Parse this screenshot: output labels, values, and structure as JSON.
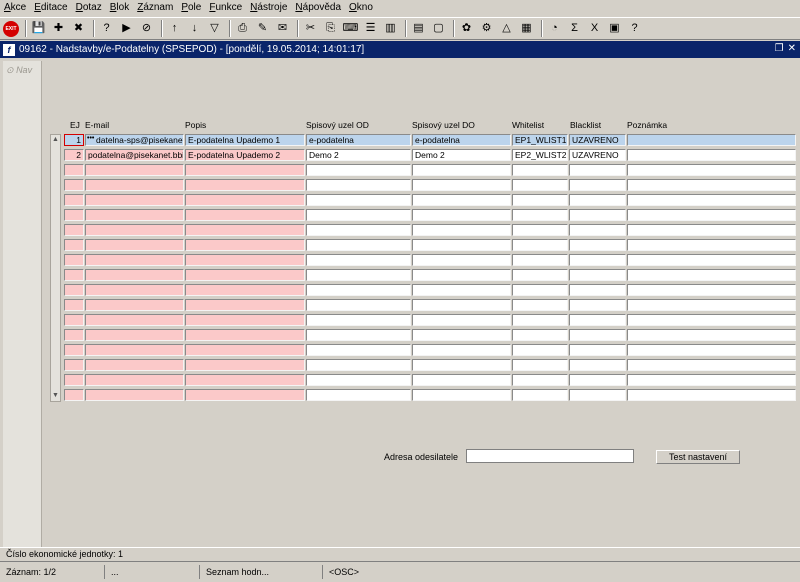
{
  "menu": [
    "Akce",
    "Editace",
    "Dotaz",
    "Blok",
    "Záznam",
    "Pole",
    "Funkce",
    "Nástroje",
    "Nápověda",
    "Okno"
  ],
  "toolbar_icons": [
    "exit-icon",
    "save-icon",
    "new-record-icon",
    "delete-record-icon",
    "enter-query-icon",
    "execute-query-icon",
    "cancel-query-icon",
    "sort-asc-icon",
    "sort-desc-icon",
    "filter-icon",
    "print-icon",
    "attachment-icon",
    "mail-icon",
    "cut-icon",
    "copy-icon",
    "paste-icon",
    "indent-icon",
    "columns-icon",
    "report-icon",
    "document-icon",
    "settings-icon",
    "gear-icon",
    "warning-icon",
    "chart-icon",
    "history-icon",
    "sum-icon",
    "excel-icon",
    "calculator-icon",
    "help-icon"
  ],
  "window": {
    "title": "09162 - Nadstavby/e-Podatelny (SPSEPOD) - [pondělí, 19.05.2014; 14:01:17]",
    "icon_letter": "f"
  },
  "nav_label": "Nav",
  "columns": [
    "EJ",
    "E-mail",
    "Popis",
    "Spisový uzel OD",
    "Spisový uzel DO",
    "Whitelist",
    "Blacklist",
    "Poznámka"
  ],
  "rows": [
    {
      "ej": "1",
      "email": "datelna-sps@pisekanet.bbi",
      "popis": "E-podatelna Upademo 1",
      "od": "e-podatelna",
      "do": "e-podatelna",
      "whitelist": "EP1_WLIST1",
      "blacklist": "UZAVRENO",
      "poznamka": ""
    },
    {
      "ej": "2",
      "email": "podatelna@pisekanet.bbi",
      "popis": "E-podatelna Upademo 2",
      "od": "Demo 2",
      "do": "Demo 2",
      "whitelist": "EP2_WLIST2",
      "blacklist": "UZAVRENO",
      "poznamka": ""
    }
  ],
  "empty_rows": 16,
  "form": {
    "sender_label": "Adresa odesilatele",
    "sender_value": "",
    "test_button": "Test nastavení"
  },
  "status": {
    "line1": "Číslo ekonomické jednotky: 1",
    "record": "Záznam: 1/2",
    "dots": "...",
    "list": "Seznam hodn...",
    "osc": "<OSC>"
  },
  "colors": {
    "title_bar": "#0a246a",
    "required_field": "#fbc9c9",
    "selected_row": "#bcd4ec"
  }
}
